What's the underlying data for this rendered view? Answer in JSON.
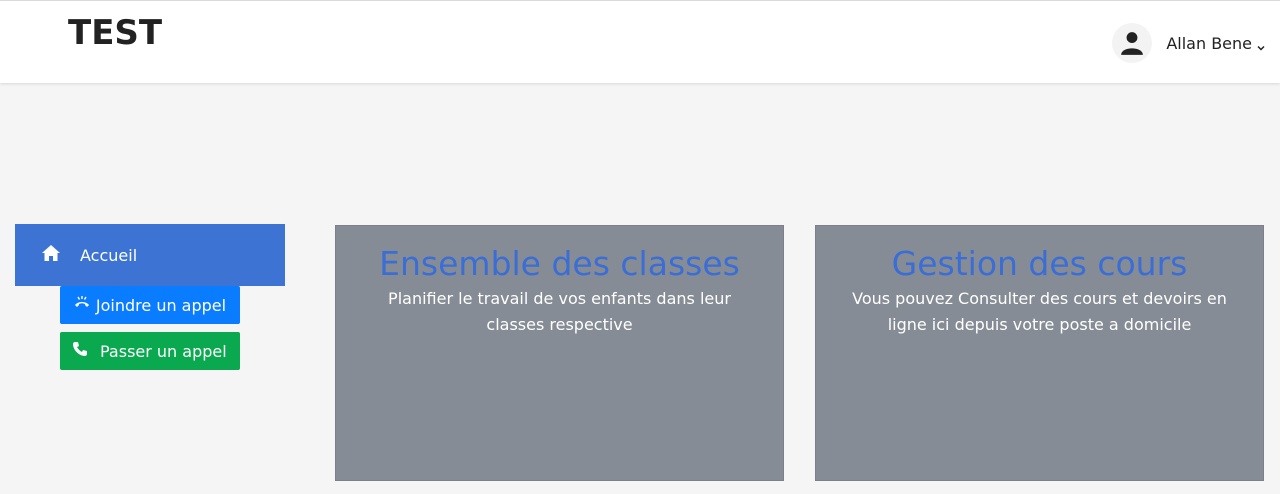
{
  "header": {
    "brand": "TEST",
    "user_name": "Allan Bene",
    "icons": {
      "avatar": "user-icon",
      "dropdown": "chevron-down-icon"
    }
  },
  "sidebar": {
    "home_label": "Accueil",
    "home_icon": "home-icon",
    "join_call_label": "Joindre un appel",
    "join_call_icon": "hangup-phone-icon",
    "place_call_label": "Passer un appel",
    "place_call_icon": "phone-icon"
  },
  "cards": [
    {
      "title": "Ensemble des classes",
      "text": "Planifier le travail de vos enfants dans leur classes respective"
    },
    {
      "title": "Gestion des cours",
      "text": "Vous pouvez Consulter des cours et devoirs en ligne ici depuis votre poste a domicile"
    }
  ],
  "colors": {
    "primary": "#3d73d2",
    "join_button": "#0a7cff",
    "call_button": "#0aa84f",
    "card_bg": "#868c95",
    "card_title": "#3a6ed6"
  }
}
